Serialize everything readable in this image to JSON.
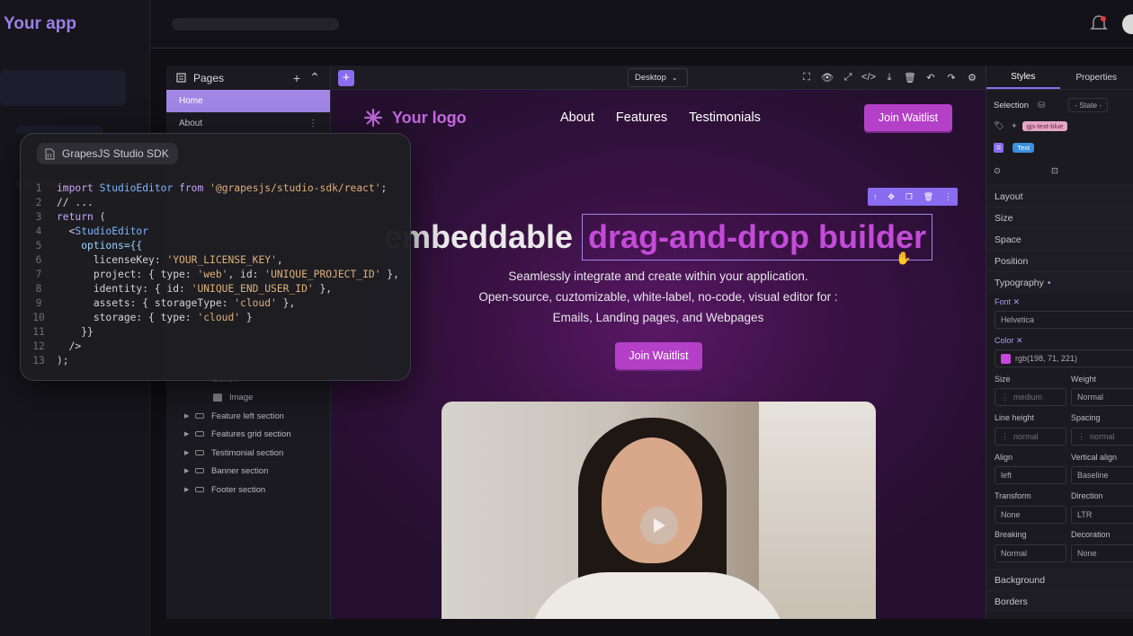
{
  "app": {
    "title": "Your app"
  },
  "pages": {
    "header": "Pages",
    "items": [
      {
        "label": "Home",
        "active": true
      },
      {
        "label": "About",
        "active": false
      }
    ],
    "layers": [
      {
        "label": "Button",
        "type": "text"
      },
      {
        "label": "Image",
        "type": "image"
      },
      {
        "label": "Feature left section",
        "type": "section"
      },
      {
        "label": "Features grid section",
        "type": "section"
      },
      {
        "label": "Testimonial section",
        "type": "section"
      },
      {
        "label": "Banner section",
        "type": "section"
      },
      {
        "label": "Footer section",
        "type": "section"
      }
    ]
  },
  "toolbar": {
    "device": "Desktop"
  },
  "canvas": {
    "logo": "Your logo",
    "nav": [
      "About",
      "Features",
      "Testimonials"
    ],
    "cta_top": "Join Waitlist",
    "hero_word": "embeddable",
    "hero_highlight": "drag-and-drop builder",
    "subtitle_lines": [
      "Seamlessly integrate and create within your application.",
      "Open-source, cuztomizable, white-label, no-code, visual editor for :",
      "Emails, Landing pages, and Webpages"
    ],
    "cta_mid": "Join Waitlist"
  },
  "styles": {
    "tabs": [
      "Styles",
      "Properties"
    ],
    "selection_label": "Selection",
    "state_label": "- State -",
    "class_chip": "gjs-text-blue",
    "type_chip": "Text",
    "sections": [
      "Layout",
      "Size",
      "Space",
      "Position",
      "Typography",
      "Background",
      "Borders"
    ],
    "font": {
      "label": "Font",
      "value": "Helvetica"
    },
    "color": {
      "label": "Color",
      "value": "rgb(198, 71, 221)",
      "swatch": "#c647dd"
    },
    "size": {
      "label": "Size",
      "placeholder": "medium"
    },
    "weight": {
      "label": "Weight",
      "value": "Normal"
    },
    "line_height": {
      "label": "Line height",
      "placeholder": "normal"
    },
    "spacing": {
      "label": "Spacing",
      "placeholder": "normal"
    },
    "align": {
      "label": "Align",
      "value": "left"
    },
    "vertical_align": {
      "label": "Vertical align",
      "value": "Baseline"
    },
    "transform": {
      "label": "Transform",
      "value": "None"
    },
    "direction": {
      "label": "Direction",
      "value": "LTR"
    },
    "breaking": {
      "label": "Breaking",
      "value": "Normal"
    },
    "decoration": {
      "label": "Decoration",
      "value": "None"
    }
  },
  "code_card": {
    "title": "GrapesJS Studio SDK",
    "lines": [
      "1",
      "2",
      "3",
      "4",
      "5",
      "6",
      "7",
      "8",
      "9",
      "10",
      "11",
      "12",
      "13"
    ],
    "kw_import": "import",
    "name_editor": "StudioEditor",
    "kw_from": "from",
    "pkg": "'@grapesjs/studio-sdk/react'",
    "comment": "// ...",
    "kw_return": "return",
    "license_key": "licenseKey:",
    "license_val": "'YOUR_LICENSE_KEY'",
    "project_key": "project: { type: ",
    "project_type": "'web'",
    "project_id_key": ", id: ",
    "project_id": "'UNIQUE_PROJECT_ID'",
    "identity_key": "identity: { id: ",
    "identity_id": "'UNIQUE_END_USER_ID'",
    "assets_key": "assets: { storageType: ",
    "assets_val": "'cloud'",
    "storage_key": "storage: { type: ",
    "storage_val": "'cloud'",
    "options": "options={{"
  },
  "colors": {
    "accent": "#8a6cf0",
    "brand": "#b540c8",
    "highlight": "#c34bd8"
  }
}
